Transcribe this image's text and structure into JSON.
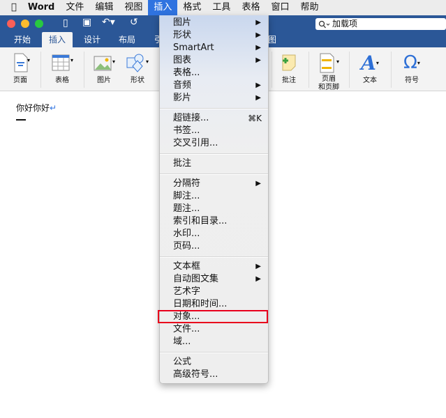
{
  "menubar": {
    "apple": "",
    "app": "Word",
    "items": [
      "文件",
      "编辑",
      "视图",
      "插入",
      "格式",
      "工具",
      "表格",
      "窗口",
      "帮助"
    ],
    "active": "插入"
  },
  "search": {
    "placeholder": "加载项"
  },
  "tabs": {
    "items": [
      "开始",
      "插入",
      "设计",
      "布局",
      "引",
      "图"
    ],
    "selected": "插入"
  },
  "ribbon": {
    "buttons": [
      "页面",
      "表格",
      "图片",
      "形状",
      "批注",
      "页眉\n和页脚",
      "文本",
      "符号"
    ]
  },
  "document": {
    "text": "你好你好"
  },
  "insert_menu": {
    "groups": [
      [
        {
          "label": "图片",
          "submenu": true
        },
        {
          "label": "形状",
          "submenu": true
        },
        {
          "label": "SmartArt",
          "submenu": true
        },
        {
          "label": "图表",
          "submenu": true
        },
        {
          "label": "表格..."
        },
        {
          "label": "音频",
          "submenu": true
        },
        {
          "label": "影片",
          "submenu": true
        }
      ],
      [
        {
          "label": "超链接...",
          "shortcut": "⌘K"
        },
        {
          "label": "书签..."
        },
        {
          "label": "交叉引用..."
        }
      ],
      [
        {
          "label": "批注"
        }
      ],
      [
        {
          "label": "分隔符",
          "submenu": true
        },
        {
          "label": "脚注..."
        },
        {
          "label": "题注..."
        },
        {
          "label": "索引和目录..."
        },
        {
          "label": "水印..."
        },
        {
          "label": "页码..."
        }
      ],
      [
        {
          "label": "文本框",
          "submenu": true
        },
        {
          "label": "自动图文集",
          "submenu": true
        },
        {
          "label": "艺术字"
        },
        {
          "label": "日期和时间..."
        },
        {
          "label": "对象...",
          "highlighted": true
        },
        {
          "label": "文件..."
        },
        {
          "label": "域..."
        }
      ],
      [
        {
          "label": "公式"
        },
        {
          "label": "高级符号..."
        }
      ]
    ]
  },
  "colors": {
    "titlebar": "#2b5797",
    "highlight_box": "#e8001c",
    "menu_active": "#2f73e0"
  }
}
